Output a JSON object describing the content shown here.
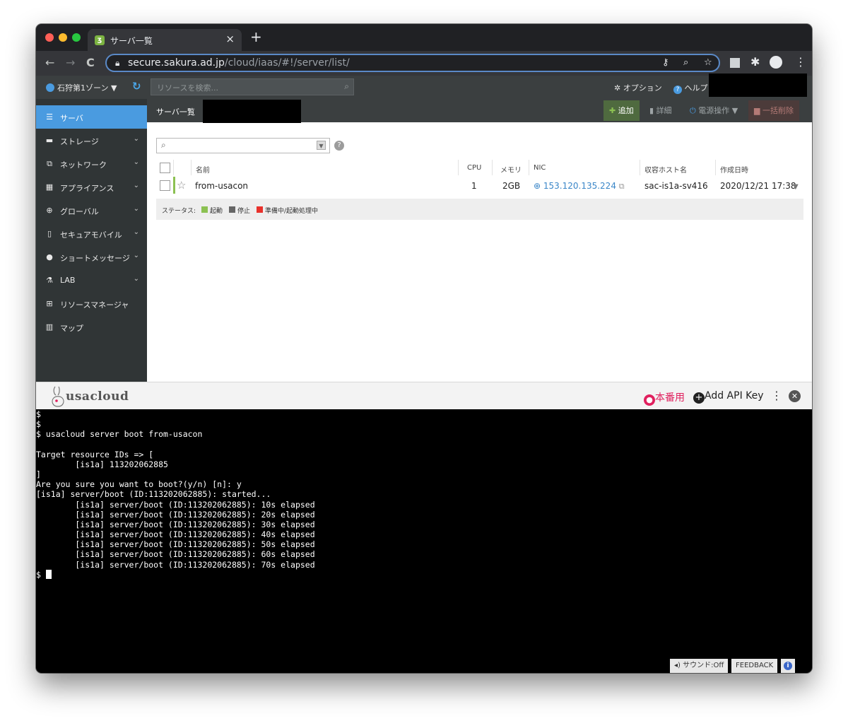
{
  "browser": {
    "tab_title": "サーバ一覧",
    "tab_favicon": "ʒ",
    "close_glyph": "×",
    "new_tab_glyph": "+",
    "url_host": "secure.sakura.ad.jp",
    "url_path": "/cloud/iaas/#!/server/list/",
    "back_glyph": "←",
    "forward_glyph": "→",
    "reload_glyph": "C"
  },
  "app_header": {
    "zone_label": "石狩第1ゾーン ▼",
    "search_placeholder": "リソースを検索...",
    "options_label": "オプション",
    "help_label": "ヘルプ"
  },
  "sidebar": {
    "items": [
      {
        "label": "サーバ",
        "icon": "server-icon",
        "active": true
      },
      {
        "label": "ストレージ",
        "icon": "storage-icon"
      },
      {
        "label": "ネットワーク",
        "icon": "network-icon"
      },
      {
        "label": "アプライアンス",
        "icon": "appliance-icon"
      },
      {
        "label": "グローバル",
        "icon": "globe-icon"
      },
      {
        "label": "セキュアモバイル",
        "icon": "mobile-icon"
      },
      {
        "label": "ショートメッセージ",
        "icon": "message-icon"
      },
      {
        "label": "LAB",
        "icon": "flask-icon"
      },
      {
        "label": "リソースマネージャ",
        "icon": "sitemap-icon"
      },
      {
        "label": "マップ",
        "icon": "map-icon"
      }
    ]
  },
  "list": {
    "title": "サーバ一覧",
    "add_label": "追加",
    "detail_label": "詳細",
    "power_label": "電源操作 ▼",
    "bulk_delete_label": "一括削除",
    "columns": [
      "名前",
      "CPU",
      "メモリ",
      "NIC",
      "収容ホスト名",
      "作成日時"
    ],
    "rows": [
      {
        "name": "from-usacon",
        "cpu": "1",
        "memory": "2GB",
        "nic": "153.120.135.224",
        "host": "sac-is1a-sv416",
        "created": "2020/12/21 17:38"
      }
    ],
    "status_legend": {
      "prefix": "ステータス:",
      "items": [
        {
          "label": "起動",
          "color": "#8cc152"
        },
        {
          "label": "停止",
          "color": "#666666"
        },
        {
          "label": "準備中/起動処理中",
          "color": "#e8312b"
        }
      ]
    }
  },
  "usacloud": {
    "logo_text": "usacloud",
    "profile_label": "本番用",
    "add_api_key_label": "Add API Key"
  },
  "terminal": {
    "lines": [
      "$",
      "$",
      "$ usacloud server boot from-usacon",
      "",
      "Target resource IDs => [",
      "        [is1a] 113202062885",
      "]",
      "Are you sure you want to boot?(y/n) [n]: y",
      "[is1a] server/boot (ID:113202062885): started...",
      "        [is1a] server/boot (ID:113202062885): 10s elapsed",
      "        [is1a] server/boot (ID:113202062885): 20s elapsed",
      "        [is1a] server/boot (ID:113202062885): 30s elapsed",
      "        [is1a] server/boot (ID:113202062885): 40s elapsed",
      "        [is1a] server/boot (ID:113202062885): 50s elapsed",
      "        [is1a] server/boot (ID:113202062885): 60s elapsed",
      "        [is1a] server/boot (ID:113202062885): 70s elapsed"
    ],
    "prompt": "$ "
  },
  "footer": {
    "sound_label": "サウンド:Off",
    "feedback_label": "FEEDBACK",
    "info_glyph": "i"
  },
  "colors": {
    "accent": "#4a9be0",
    "running": "#8cc152",
    "stopped": "#666666",
    "pending": "#e8312b",
    "production": "#e0205e"
  }
}
